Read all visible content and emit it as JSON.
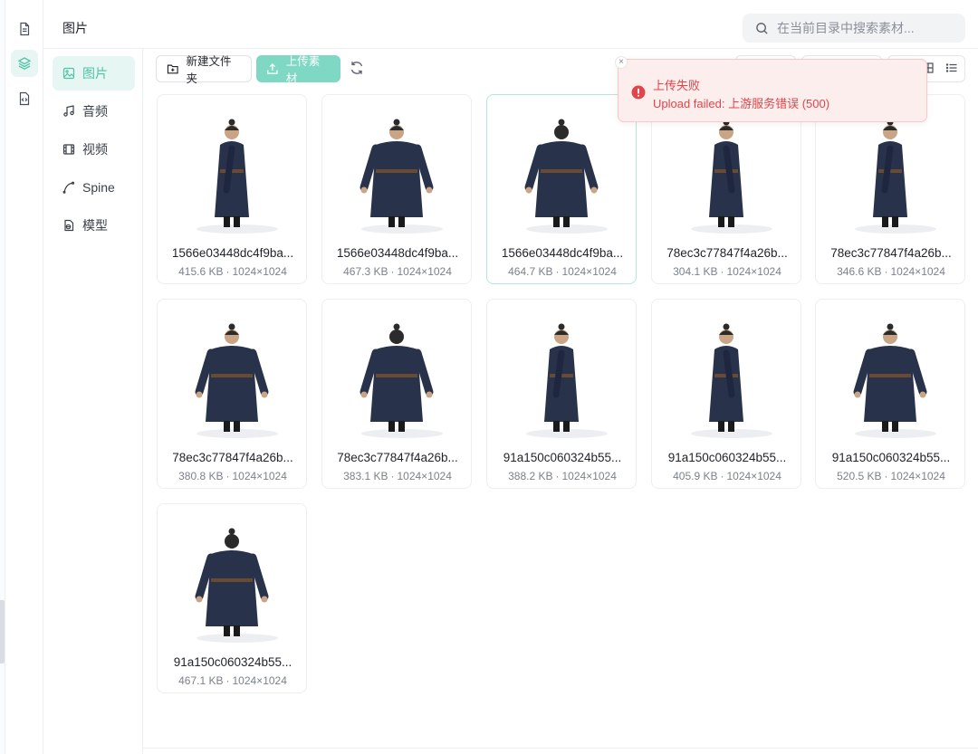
{
  "header": {
    "title": "图片",
    "search_placeholder": "在当前目录中搜索素材..."
  },
  "rail": {
    "icons": [
      "document-icon",
      "layers-icon",
      "code-file-icon"
    ]
  },
  "nav": {
    "items": [
      {
        "label": "图片",
        "icon": "image-icon",
        "active": true
      },
      {
        "label": "音频",
        "icon": "music-note-icon",
        "active": false
      },
      {
        "label": "视频",
        "icon": "film-icon",
        "active": false
      },
      {
        "label": "Spine",
        "icon": "spine-curve-icon",
        "active": false
      },
      {
        "label": "模型",
        "icon": "model-cube-icon",
        "active": false
      }
    ]
  },
  "toolbar": {
    "new_folder_label": "新建文件夹",
    "upload_label": "上传素材",
    "refresh_icon": "refresh-icon"
  },
  "toast": {
    "title": "上传失败",
    "message": "Upload failed: 上游服务错误 (500)",
    "close_symbol": "×",
    "icon": "error-circle-icon",
    "color": "#e0454a"
  },
  "assets": [
    {
      "name": "1566e03448dc4f9ba...",
      "size": "415.6 KB",
      "dims": "1024×1024",
      "pose": "side-left"
    },
    {
      "name": "1566e03448dc4f9ba...",
      "size": "467.3 KB",
      "dims": "1024×1024",
      "pose": "front"
    },
    {
      "name": "1566e03448dc4f9ba...",
      "size": "464.7 KB",
      "dims": "1024×1024",
      "pose": "back"
    },
    {
      "name": "78ec3c77847f4a26b...",
      "size": "304.1 KB",
      "dims": "1024×1024",
      "pose": "side-right"
    },
    {
      "name": "78ec3c77847f4a26b...",
      "size": "346.6 KB",
      "dims": "1024×1024",
      "pose": "side-left"
    },
    {
      "name": "78ec3c77847f4a26b...",
      "size": "380.8 KB",
      "dims": "1024×1024",
      "pose": "front"
    },
    {
      "name": "78ec3c77847f4a26b...",
      "size": "383.1 KB",
      "dims": "1024×1024",
      "pose": "back"
    },
    {
      "name": "91a150c060324b55...",
      "size": "388.2 KB",
      "dims": "1024×1024",
      "pose": "side-left"
    },
    {
      "name": "91a150c060324b55...",
      "size": "405.9 KB",
      "dims": "1024×1024",
      "pose": "side-right"
    },
    {
      "name": "91a150c060324b55...",
      "size": "520.5 KB",
      "dims": "1024×1024",
      "pose": "front"
    },
    {
      "name": "91a150c060324b55...",
      "size": "467.1 KB",
      "dims": "1024×1024",
      "pose": "back"
    }
  ],
  "colors": {
    "accent": "#52c2a8",
    "accent_bg": "#e6f6f2",
    "primary_button": "#7fd8c3",
    "robe": "#28324a",
    "error": "#e0454a"
  }
}
